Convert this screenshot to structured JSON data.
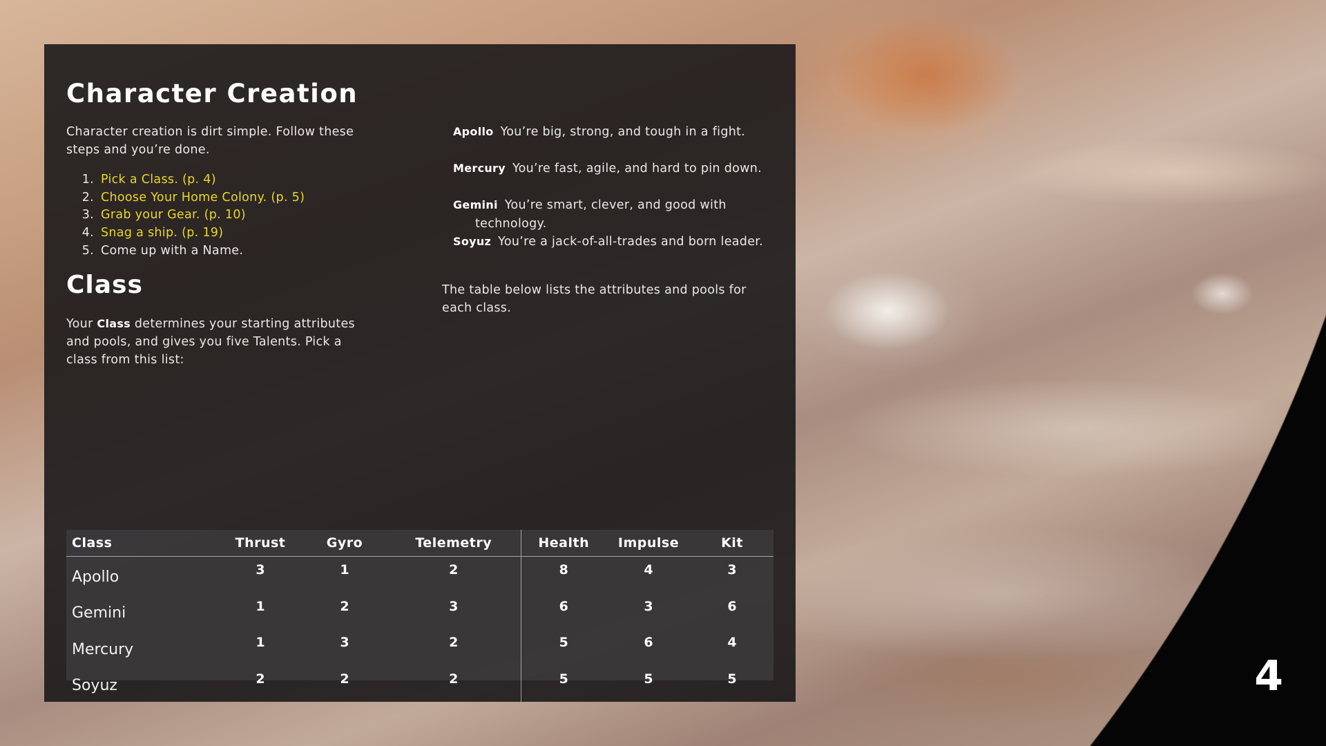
{
  "title": "Character Creation",
  "intro": "Character creation is dirt simple. Follow these steps and you’re done.",
  "steps": [
    {
      "num": "1.",
      "text": "Pick a Class. (p. 4)",
      "link": true
    },
    {
      "num": "2.",
      "text": "Choose Your Home Colony. (p. 5)",
      "link": true
    },
    {
      "num": "3.",
      "text": "Grab your Gear. (p. 10)",
      "link": true
    },
    {
      "num": "4.",
      "text": "Snag a ship. (p. 19)",
      "link": true
    },
    {
      "num": "5.",
      "text": "Come up with a Name.",
      "link": false
    }
  ],
  "class_heading": "Class",
  "class_text": {
    "before": "Your ",
    "bold": "Class",
    "after": " determines your starting attributes and pools, and gives you five Talents. Pick a class from this list:"
  },
  "classes": [
    {
      "name": "Apollo",
      "desc": "You’re big, strong, and tough in a fight."
    },
    {
      "name": "Mercury",
      "desc": "You’re fast, agile, and hard to pin down."
    },
    {
      "name": "Gemini",
      "desc": "You’re smart, clever, and good with technology."
    },
    {
      "name": "Soyuz",
      "desc": "You’re a jack-of-all-trades and born leader."
    }
  ],
  "table_intro": "The table below lists the attributes and pools for each class.",
  "table": {
    "headers": [
      "Class",
      "Thrust",
      "Gyro",
      "Telemetry",
      "Health",
      "Impulse",
      "Kit"
    ],
    "rows": [
      [
        "Apollo",
        "3",
        "1",
        "2",
        "8",
        "4",
        "3"
      ],
      [
        "Gemini",
        "1",
        "2",
        "3",
        "6",
        "3",
        "6"
      ],
      [
        "Mercury",
        "1",
        "3",
        "2",
        "5",
        "6",
        "4"
      ],
      [
        "Soyuz",
        "2",
        "2",
        "2",
        "5",
        "5",
        "5"
      ]
    ]
  },
  "page_number": "4",
  "colors": {
    "link": "#e8d826",
    "panel": "#1c1a1b"
  }
}
